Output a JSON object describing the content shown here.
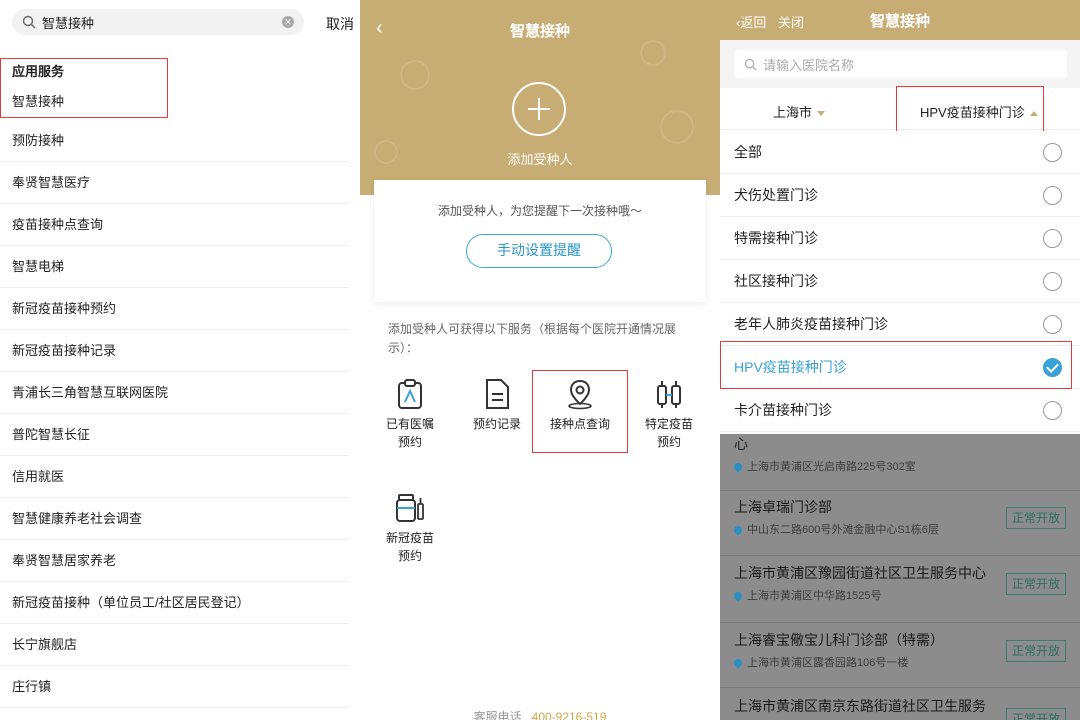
{
  "panel1": {
    "search_query": "智慧接种",
    "cancel_label": "取消",
    "section_title": "应用服务",
    "first_item": "智慧接种",
    "items": [
      "预防接种",
      "奉贤智慧医疗",
      "疫苗接种点查询",
      "智慧电梯",
      "新冠疫苗接种预约",
      "新冠疫苗接种记录",
      "青浦长三角智慧互联网医院",
      "普陀智慧长征",
      "信用就医",
      "智慧健康养老社会调查",
      "奉贤智慧居家养老",
      "新冠疫苗接种（单位员工/社区居民登记）",
      "长宁旗舰店",
      "庄行镇"
    ]
  },
  "panel2": {
    "title": "智慧接种",
    "add_label": "添加受种人",
    "card_text": "添加受种人，为您提醒下一次接种哦～",
    "remind_button": "手动设置提醒",
    "info_text": "添加受种人可获得以下服务（根据每个医院开通情况展示）：",
    "services": {
      "s1": [
        "已有医嘱",
        "预约"
      ],
      "s2": [
        "预约记录"
      ],
      "s3": [
        "接种点查询"
      ],
      "s4": [
        "特定疫苗",
        "预约"
      ],
      "s5": [
        "新冠疫苗",
        "预约"
      ]
    },
    "footer_label": "客服电话",
    "footer_phone": "400-9216-519"
  },
  "panel3": {
    "back_label": "返回",
    "close_label": "关闭",
    "title": "智慧接种",
    "search_placeholder": "请输入医院名称",
    "city": "上海市",
    "clinic_type": "HPV疫苗接种门诊",
    "options": [
      "全部",
      "犬伤处置门诊",
      "特需接种门诊",
      "社区接种门诊",
      "老年人肺炎疫苗接种门诊",
      "HPV疫苗接种门诊",
      "卡介苗接种门诊"
    ],
    "selected_index": 5,
    "results_fragment": "心",
    "results": [
      {
        "name": "",
        "address": "上海市黄浦区光启南路225号302室",
        "status": ""
      },
      {
        "name": "上海卓瑞门诊部",
        "address": "中山东二路600号外滩金融中心S1栋6层",
        "status": "正常开放"
      },
      {
        "name": "上海市黄浦区豫园街道社区卫生服务中心",
        "address": "上海市黄浦区中华路1525号",
        "status": "正常开放"
      },
      {
        "name": "上海睿宝儆宝儿科门诊部（特需）",
        "address": "上海市黄浦区露香园路106号一楼",
        "status": "正常开放"
      },
      {
        "name": "上海市黄浦区南京东路街道社区卫生服务",
        "address": "",
        "status": "正常开放"
      }
    ],
    "colors": {
      "accent": "#c7ac74",
      "selected": "#3aa0d8",
      "highlight_box": "#e23b3b"
    }
  }
}
